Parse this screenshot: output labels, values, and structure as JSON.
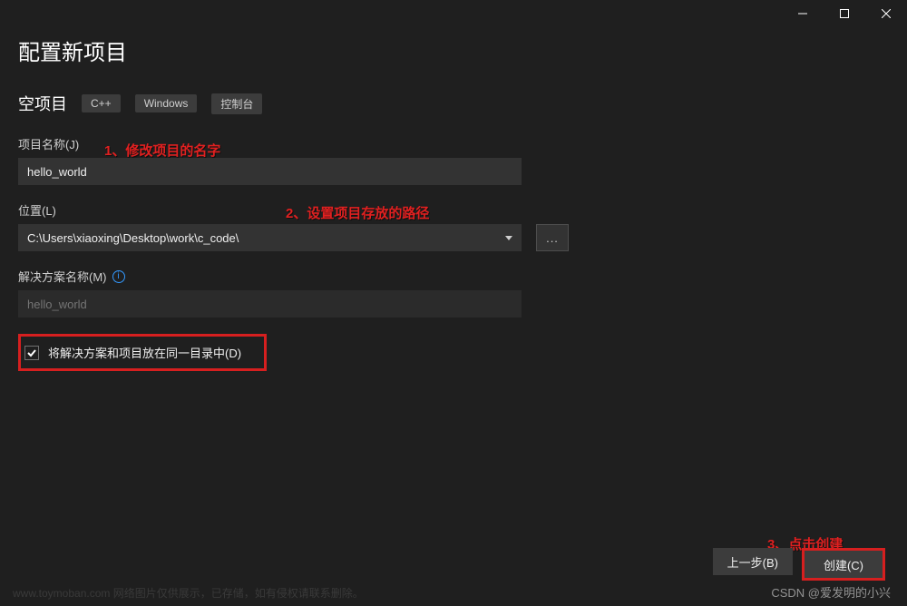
{
  "window": {
    "minimize": "—",
    "maximize": "□",
    "close": "✕"
  },
  "page": {
    "title": "配置新项目",
    "project_type": "空项目",
    "tags": [
      "C++",
      "Windows",
      "控制台"
    ]
  },
  "fields": {
    "project_name_label": "项目名称(J)",
    "project_name_value": "hello_world",
    "location_label": "位置(L)",
    "location_value": "C:\\Users\\xiaoxing\\Desktop\\work\\c_code\\",
    "browse": "...",
    "solution_name_label": "解决方案名称(M)",
    "solution_name_placeholder": "hello_world",
    "checkbox_label": "将解决方案和项目放在同一目录中(D)"
  },
  "annotations": {
    "a1": "1、修改项目的名字",
    "a2": "2、设置项目存放的路径",
    "a3": "3、点击创建"
  },
  "footer": {
    "back": "上一步(B)",
    "create": "创建(C)"
  },
  "watermark": "CSDN @爱发明的小兴",
  "toymark": "www.toymoban.com  网络图片仅供展示，已存储，如有侵权请联系删除。"
}
